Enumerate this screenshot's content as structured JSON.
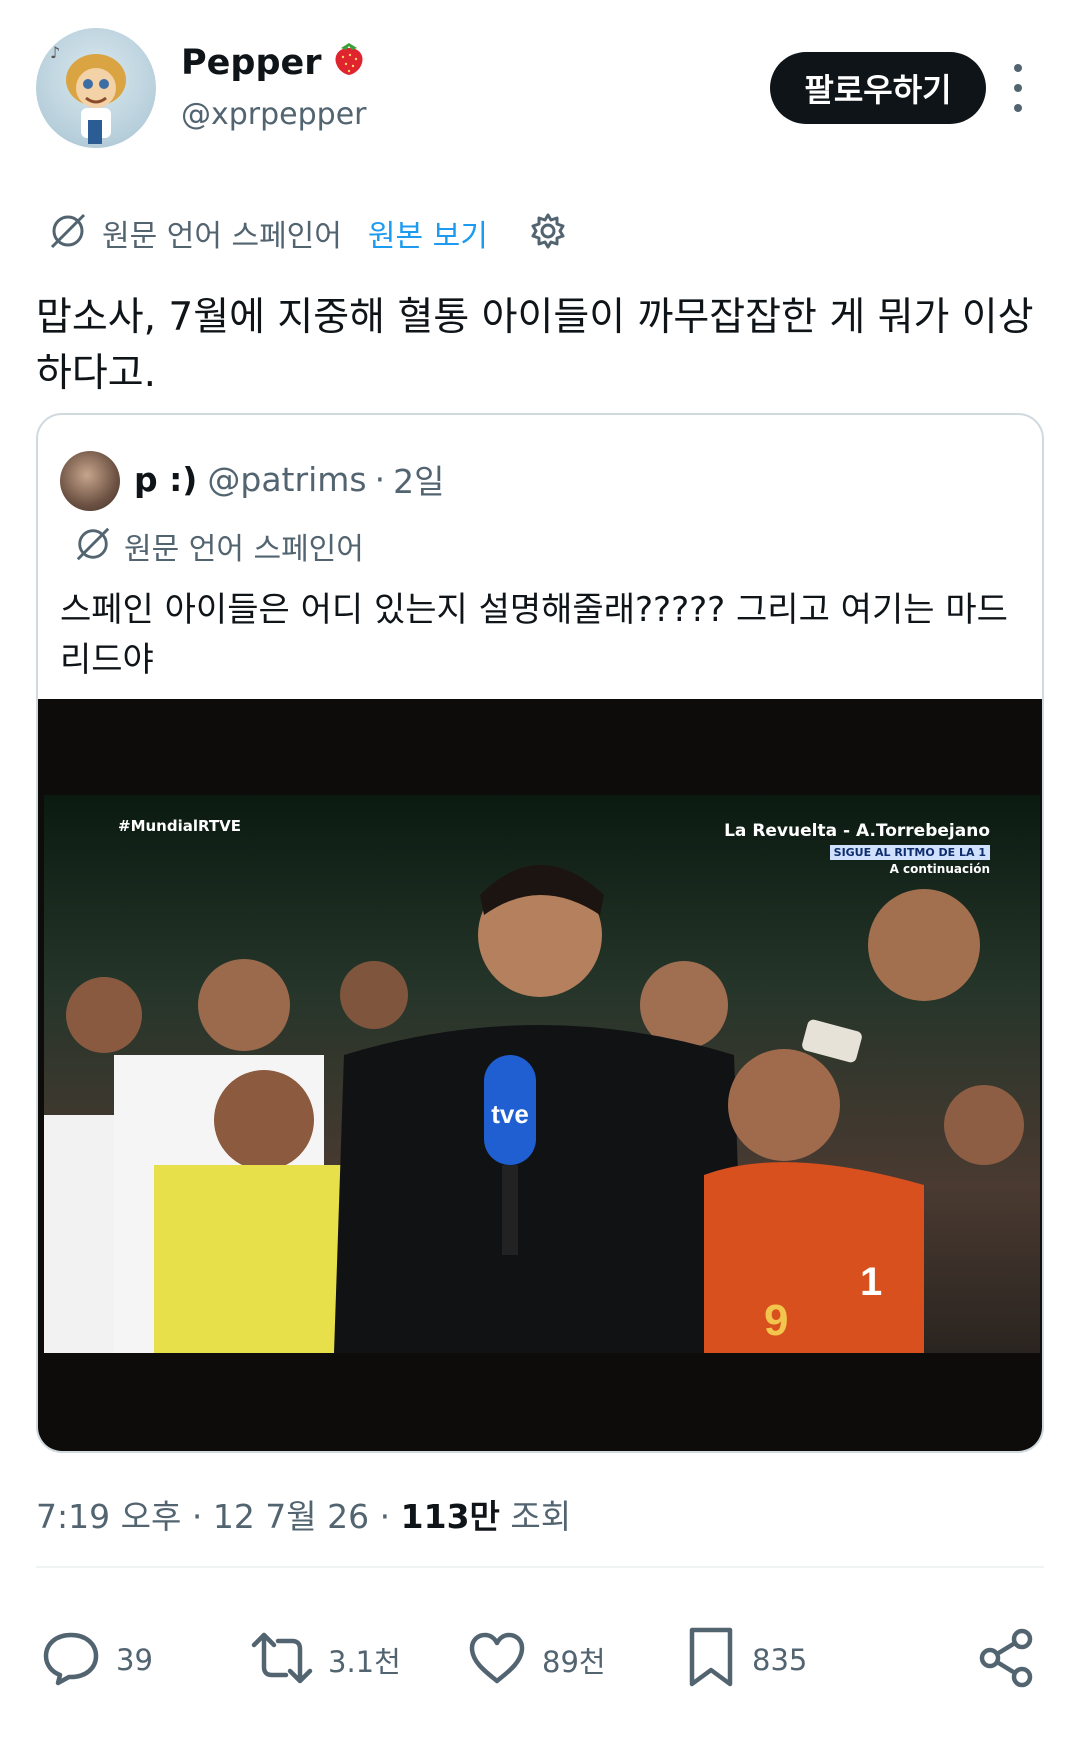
{
  "author": {
    "display_name": "Pepper",
    "name_emoji": "strawberry-emoji",
    "handle": "@xprpepper",
    "follow_label": "팔로우하기"
  },
  "translation": {
    "language_note": "원문 언어 스페인어",
    "show_original_label": "원본 보기"
  },
  "tweet_text": "맙소사, 7월에 지중해 혈통 아이들이 까무잡잡한 게 뭐가 이상하다고.",
  "quote": {
    "display_name": "p :)",
    "handle": "@patrims",
    "separator": "·",
    "time": "2일",
    "language_note": "원문 언어 스페인어",
    "text": "스페인 아이들은 어디 있는지 설명해줄래?????  그리고 여기는 마드리드야",
    "media": {
      "hashtag": "#MundialRTVE",
      "show_title": "La Revuelta - A.Torrebejano",
      "show_sub": "SIGUE AL RITMO DE LA 1",
      "show_next": "A continuación",
      "mic_logo": "tve",
      "jersey_number": "1"
    }
  },
  "meta": {
    "time": "7:19 오후",
    "date": "12 7월 26",
    "views_number": "113만",
    "views_label": "조회",
    "separator": "·"
  },
  "actions": {
    "replies": "39",
    "reposts": "3.1천",
    "likes": "89천",
    "bookmarks": "835"
  },
  "colors": {
    "text_primary": "#0f1419",
    "text_secondary": "#536471",
    "accent": "#1d9bf0",
    "border": "#cfd9de"
  }
}
